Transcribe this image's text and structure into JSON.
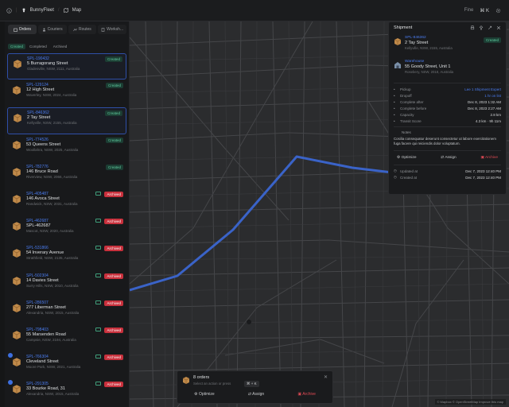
{
  "app": {
    "name": "BunnyFleet",
    "section": "Map",
    "right_label": "Fine",
    "shortcut": "⌘ K"
  },
  "panel": {
    "tabs": [
      {
        "label": "Orders",
        "active": true
      },
      {
        "label": "Couriers",
        "active": false
      },
      {
        "label": "Routes",
        "active": false
      },
      {
        "label": "Worksh...",
        "active": false
      }
    ],
    "filters": [
      {
        "label": "Created",
        "active": true
      },
      {
        "label": "Completed",
        "active": false
      },
      {
        "label": "Archived",
        "active": false
      }
    ]
  },
  "orders": [
    {
      "id": "SPL-190432",
      "address": "5 Burragorang Street",
      "sub": "Gladesville, NSW, 2111, Australia",
      "status": "Created",
      "selected": true,
      "note": false,
      "checked": false
    },
    {
      "id": "SPL-129124",
      "address": "12 High Street",
      "sub": "Waverley, NSW, 2024, Australia",
      "status": "Created",
      "selected": false,
      "note": false,
      "checked": false
    },
    {
      "id": "SPL-846362",
      "address": "2 Tay Street",
      "sub": "Kellyville, NSW, 2155, Australia",
      "status": "Created",
      "selected": true,
      "note": false,
      "checked": false
    },
    {
      "id": "SPL-774526",
      "address": "53 Queens Street",
      "sub": "Woollahra, NSW, 2025, Australia",
      "status": "Created",
      "selected": false,
      "note": false,
      "checked": false
    },
    {
      "id": "SPL-782776",
      "address": "146 Bruce Road",
      "sub": "Riverview, NSW, 2066, Australia",
      "status": "Created",
      "selected": false,
      "note": false,
      "checked": false
    },
    {
      "id": "SPL-405487",
      "address": "146 Avoca Street",
      "sub": "Randwick, NSW, 2031, Australia",
      "status": "Archived",
      "selected": false,
      "note": true,
      "checked": false
    },
    {
      "id": "SPL-462687",
      "address": "SPL-462687",
      "sub": "Mascot, NSW, 2020, Australia",
      "status": "Archived",
      "selected": false,
      "note": true,
      "checked": false
    },
    {
      "id": "SPL-531866",
      "address": "54 Inverary Avenue",
      "sub": "Strathfield, NSW, 2135, Australia",
      "status": "Archived",
      "selected": false,
      "note": true,
      "checked": false
    },
    {
      "id": "SPL-502304",
      "address": "14 Davies Street",
      "sub": "Surry Hills, NSW, 2010, Australia",
      "status": "Archived",
      "selected": false,
      "note": true,
      "checked": false
    },
    {
      "id": "SPL-286507",
      "address": "277 Liberman Street",
      "sub": "Alexandria, NSW, 2015, Australia",
      "status": "Archived",
      "selected": false,
      "note": true,
      "checked": false
    },
    {
      "id": "SPL-798403",
      "address": "55 Marsenden Road",
      "sub": "Campsie, NSW, 2194, Australia",
      "status": "Archived",
      "selected": false,
      "note": true,
      "checked": false
    },
    {
      "id": "SPL-766304",
      "address": "Cleveland Street",
      "sub": "Moore Park, NSW, 2021, Australia",
      "status": "Archived",
      "selected": false,
      "note": true,
      "checked": true
    },
    {
      "id": "SPL-291305",
      "address": "33 Bourke Road, 31",
      "sub": "Alexandria, NSW, 2015, Australia",
      "status": "Archived",
      "selected": false,
      "note": true,
      "checked": true
    }
  ],
  "shipment": {
    "title": "Shipment",
    "pickup": {
      "id": "SPL-846362",
      "address": "2 Tay Street",
      "sub": "Kellyville, NSW, 2155, Australia",
      "button": "Created"
    },
    "dropoff": {
      "id": "Warehouse",
      "address": "55 Goody Street, Unit 1",
      "sub": "Rosebery, NSW, 2018, Australia"
    },
    "rows1": [
      {
        "label": "Pickup",
        "value": "Lee 1 Shipment Expert",
        "blue": true
      },
      {
        "label": "Dropoff",
        "value": "1 hr on list",
        "blue": true
      },
      {
        "label": "Complete after",
        "value": "Dec 8, 2023 1:32 AM",
        "blue": false
      },
      {
        "label": "Complete before",
        "value": "Dec 8, 2023 2:27 AM",
        "blue": false
      },
      {
        "label": "Capacity",
        "value": "2.8 km",
        "blue": false
      },
      {
        "label": "Transit Score",
        "value": "4.3 km  ·  9h 11m",
        "blue": false
      }
    ],
    "notes_label": "Notes",
    "notes_text": "Cosilia consequatur deserunt consectetur ut labore exercitationem fuga facere qui reiciendis dolor voluptatum.",
    "actions": {
      "optimize": "Optimize",
      "assign": "Assign",
      "archive": "Archive"
    },
    "rows2": [
      {
        "label": "Updated at",
        "value": "Dec 7, 2023 12:40 PM"
      },
      {
        "label": "Created at",
        "value": "Dec 7, 2023 12:40 PM"
      }
    ]
  },
  "bottom_bar": {
    "title": "8 orders",
    "subtitle": "Select an action or press",
    "kbd": "⌘ + K",
    "optimize": "Optimize",
    "assign": "Assign",
    "archive": "Archive",
    "close": "✕"
  },
  "map": {
    "attribution": "© Mapbox © OpenStreetMap  Improve this map"
  },
  "colors": {
    "accent": "#4a7cf0",
    "route": "#3a63c8",
    "created": "#5fcc9f",
    "archived": "#c8303c"
  }
}
